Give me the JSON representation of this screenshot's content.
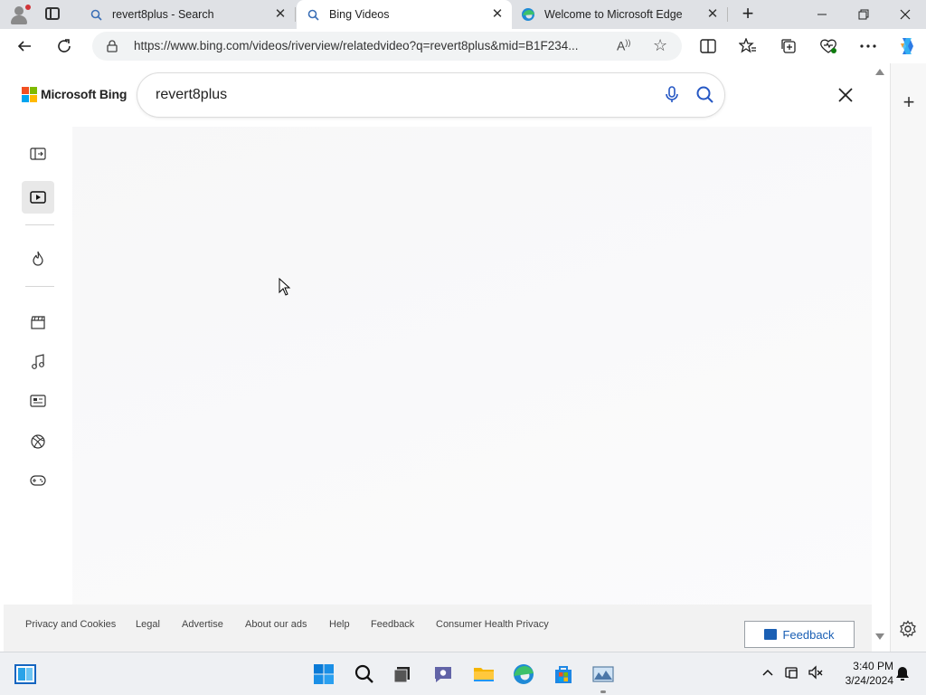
{
  "browser": {
    "tabs": [
      {
        "title": "revert8plus - Search",
        "icon": "search-icon"
      },
      {
        "title": "Bing Videos",
        "icon": "search-icon",
        "active": true
      },
      {
        "title": "Welcome to Microsoft Edge",
        "icon": "edge-icon"
      }
    ],
    "url": "https://www.bing.com/videos/riverview/relatedvideo?q=revert8plus&mid=B1F234..."
  },
  "page": {
    "brand": "Microsoft Bing",
    "search_value": "revert8plus",
    "nav_items": [
      {
        "name": "collapse-nav",
        "icon": "sidebar-expand-icon"
      },
      {
        "name": "videos",
        "icon": "video-icon",
        "active": true
      },
      {
        "name": "trending",
        "icon": "flame-icon"
      },
      {
        "name": "movies",
        "icon": "clapperboard-icon"
      },
      {
        "name": "music",
        "icon": "music-note-icon"
      },
      {
        "name": "news",
        "icon": "news-icon"
      },
      {
        "name": "sports",
        "icon": "basketball-icon"
      },
      {
        "name": "gaming",
        "icon": "gamepad-icon"
      }
    ],
    "footer_links": [
      "Privacy and Cookies",
      "Legal",
      "Advertise",
      "About our ads",
      "Help",
      "Feedback",
      "Consumer Health Privacy"
    ],
    "feedback_button": "Feedback"
  },
  "taskbar": {
    "time": "3:40 PM",
    "date": "3/24/2024"
  },
  "colors": {
    "ms_red": "#f25022",
    "ms_green": "#7fba00",
    "ms_blue": "#00a4ef",
    "ms_yellow": "#ffb900",
    "link_blue": "#1a5fb4"
  }
}
